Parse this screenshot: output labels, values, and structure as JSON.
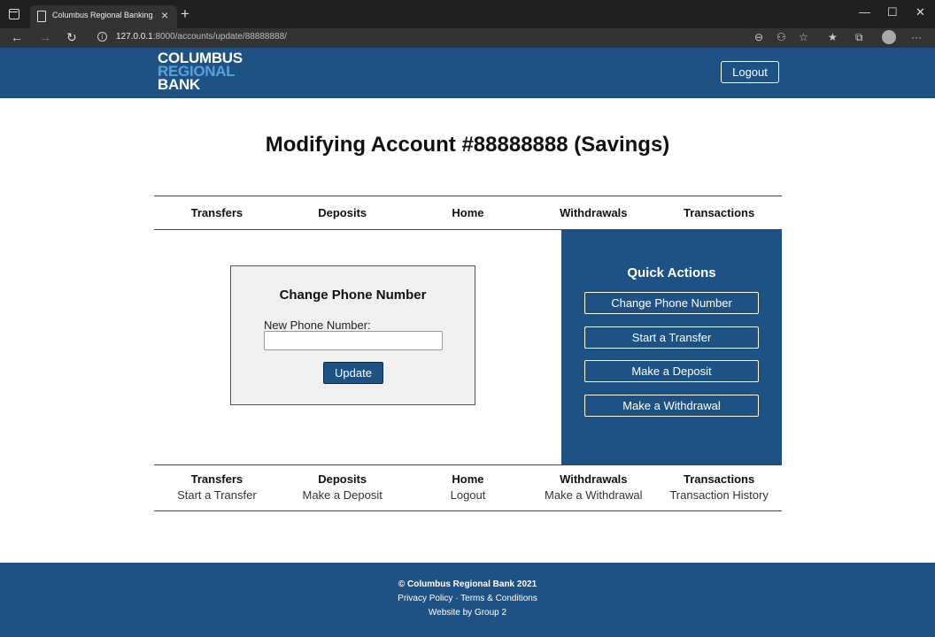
{
  "browser": {
    "tab_title": "Columbus Regional Banking",
    "url_host": "127.0.0.1",
    "url_path": ":8000/accounts/update/88888888/"
  },
  "header": {
    "logo_lines": [
      "COLUMBUS",
      "REGIONAL",
      "BANK"
    ],
    "logout_label": "Logout"
  },
  "page": {
    "title": "Modifying Account #88888888 (Savings)"
  },
  "nav": {
    "items": [
      "Transfers",
      "Deposits",
      "Home",
      "Withdrawals",
      "Transactions"
    ]
  },
  "form": {
    "title": "Change Phone Number",
    "label": "New Phone Number:",
    "value": "",
    "submit_label": "Update"
  },
  "quick_actions": {
    "title": "Quick Actions",
    "buttons": [
      "Change Phone Number",
      "Start a Transfer",
      "Make a Deposit",
      "Make a Withdrawal"
    ]
  },
  "bottom_nav": {
    "columns": [
      {
        "heading": "Transfers",
        "link": "Start a Transfer"
      },
      {
        "heading": "Deposits",
        "link": "Make a Deposit"
      },
      {
        "heading": "Home",
        "link": "Logout"
      },
      {
        "heading": "Withdrawals",
        "link": "Make a Withdrawal"
      },
      {
        "heading": "Transactions",
        "link": "Transaction History"
      }
    ]
  },
  "footer": {
    "copyright": "© Columbus Regional Bank 2021",
    "privacy": "Privacy Policy",
    "separator": "·",
    "terms": "Terms & Conditions",
    "credit": "Website by Group 2"
  },
  "colors": {
    "brand_blue": "#1e5284",
    "logo_accent": "#5aa0dd"
  }
}
